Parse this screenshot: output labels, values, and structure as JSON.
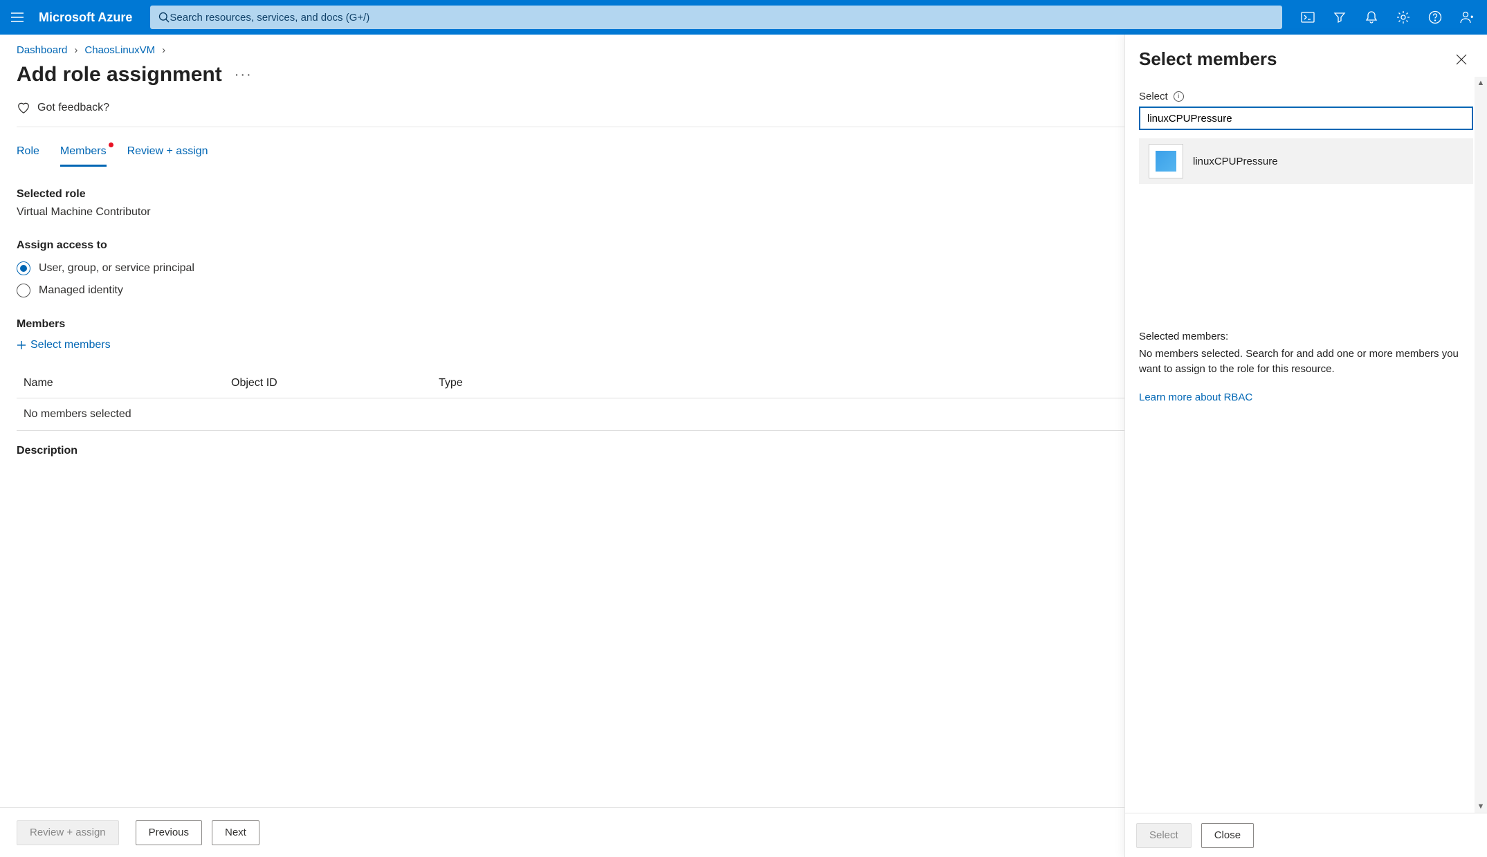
{
  "brand": "Microsoft Azure",
  "search_placeholder": "Search resources, services, and docs (G+/)",
  "breadcrumb": {
    "dashboard": "Dashboard",
    "resource": "ChaosLinuxVM"
  },
  "page_title": "Add role assignment",
  "feedback": "Got feedback?",
  "tabs": {
    "role": "Role",
    "members": "Members",
    "review": "Review + assign"
  },
  "selected_role_label": "Selected role",
  "selected_role_value": "Virtual Machine Contributor",
  "assign_access_label": "Assign access to",
  "assign_options": {
    "user": "User, group, or service principal",
    "managed": "Managed identity"
  },
  "members_label": "Members",
  "select_members_link": "Select members",
  "table": {
    "name": "Name",
    "object_id": "Object ID",
    "type": "Type",
    "empty": "No members selected"
  },
  "description_label": "Description",
  "footer": {
    "review": "Review + assign",
    "previous": "Previous",
    "next": "Next"
  },
  "panel": {
    "title": "Select members",
    "field_label": "Select",
    "input_value": "linuxCPUPressure",
    "result_name": "linuxCPUPressure",
    "selected_label": "Selected members:",
    "selected_msg": "No members selected. Search for and add one or more members you want to assign to the role for this resource.",
    "rbac_link": "Learn more about RBAC",
    "select_btn": "Select",
    "close_btn": "Close"
  }
}
